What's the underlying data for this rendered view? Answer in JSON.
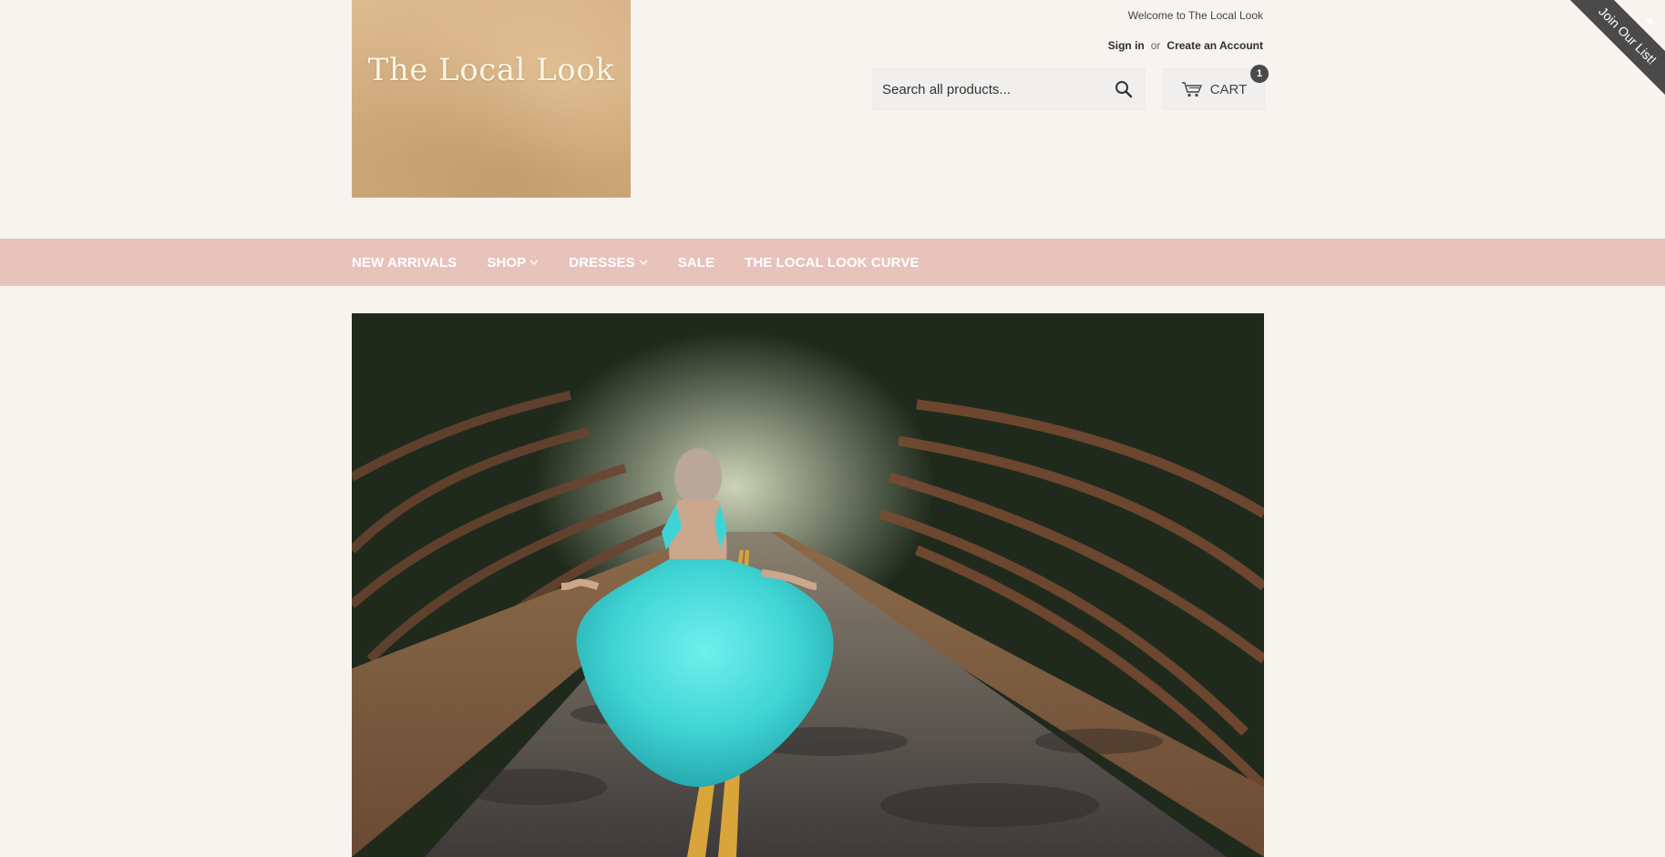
{
  "brand": {
    "logo_text": "The Local Look"
  },
  "header": {
    "welcome": "Welcome to The Local Look",
    "sign_in": "Sign in",
    "or": "or",
    "create_account": "Create an Account"
  },
  "search": {
    "placeholder": "Search all products..."
  },
  "cart": {
    "label": "CART",
    "count": "1"
  },
  "ribbon": {
    "label": "Join Our List!"
  },
  "nav": {
    "items": [
      {
        "label": "NEW ARRIVALS",
        "dropdown": false
      },
      {
        "label": "SHOP",
        "dropdown": true
      },
      {
        "label": "DRESSES",
        "dropdown": true
      },
      {
        "label": "SALE",
        "dropdown": false
      },
      {
        "label": "THE LOCAL LOOK CURVE",
        "dropdown": false
      }
    ]
  },
  "hero": {
    "alt": "Woman in a flowing turquoise dress on a tree-lined road"
  },
  "colors": {
    "nav_bg": "#e8c3bb",
    "page_bg": "#f7f4ef",
    "ribbon": "#4a4a4a"
  }
}
